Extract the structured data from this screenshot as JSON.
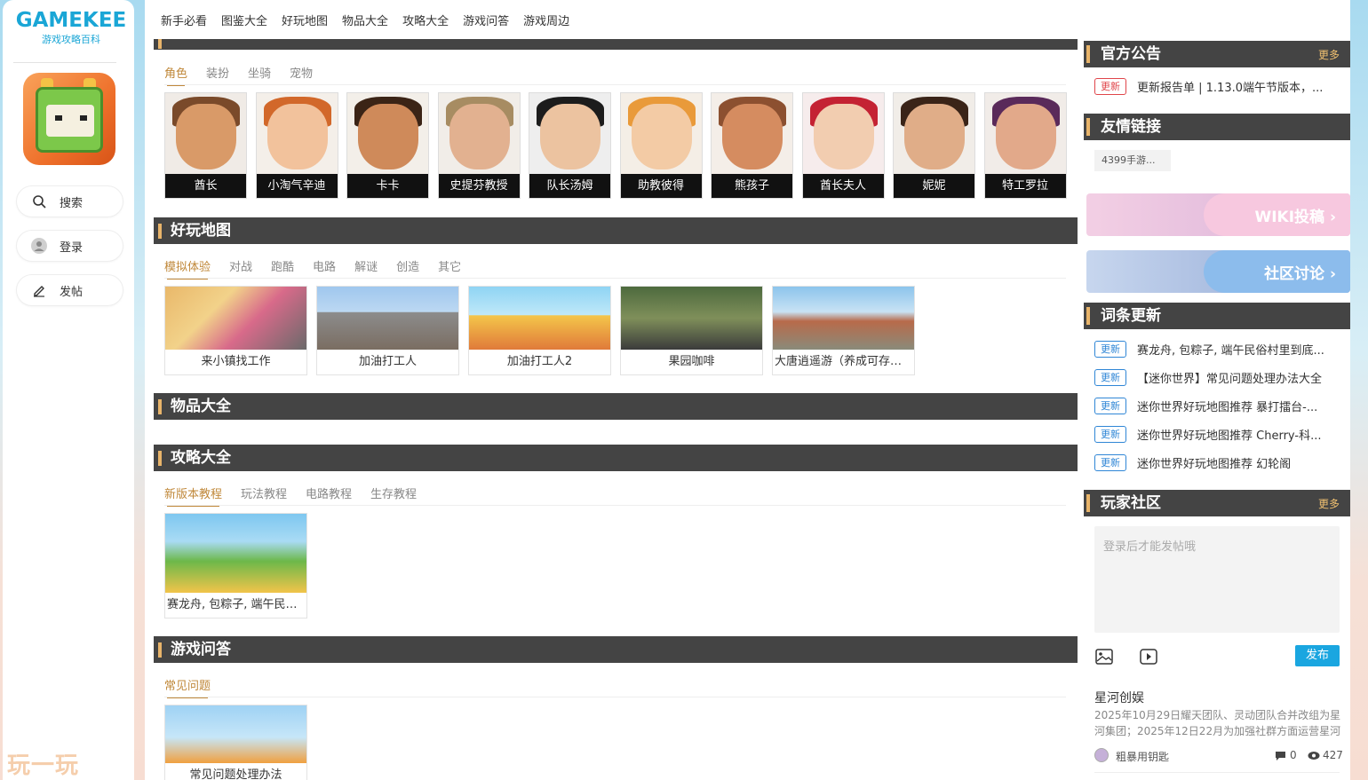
{
  "logo": {
    "text": "GAMEKEE",
    "subtitle": "游戏攻略百科"
  },
  "sidebar": {
    "search": "搜索",
    "login": "登录",
    "post": "发帖"
  },
  "watermark": "玩一玩",
  "nav": [
    "新手必看",
    "图鉴大全",
    "好玩地图",
    "物品大全",
    "攻略大全",
    "游戏问答",
    "游戏周边"
  ],
  "tujian": {
    "tabs": [
      "角色",
      "装扮",
      "坐骑",
      "宠物"
    ],
    "characters": [
      "酋长",
      "小淘气辛迪",
      "卡卡",
      "史提芬教授",
      "队长汤姆",
      "助教彼得",
      "熊孩子",
      "酋长夫人",
      "妮妮",
      "特工罗拉"
    ]
  },
  "maps": {
    "title": "好玩地图",
    "tabs": [
      "模拟体验",
      "对战",
      "跑酷",
      "电路",
      "解谜",
      "创造",
      "其它"
    ],
    "cards": [
      "来小镇找工作",
      "加油打工人",
      "加油打工人2",
      "果园咖啡",
      "大唐逍遥游（养成可存档）"
    ]
  },
  "items": {
    "title": "物品大全"
  },
  "guides": {
    "title": "攻略大全",
    "tabs": [
      "新版本教程",
      "玩法教程",
      "电路教程",
      "生存教程"
    ],
    "cards": [
      "赛龙舟, 包粽子, 端午民俗..."
    ]
  },
  "qa": {
    "title": "游戏问答",
    "tabs": [
      "常见问题"
    ],
    "cards": [
      "常见问题处理办法"
    ]
  },
  "right": {
    "announce": {
      "title": "官方公告",
      "more": "更多",
      "badge": "更新",
      "text": "更新报告单 | 1.13.0端午节版本，..."
    },
    "links": {
      "title": "友情链接",
      "chip": "4399手游..."
    },
    "wiki_banner": "WIKI投稿",
    "community_banner": "社区讨论",
    "updates": {
      "title": "词条更新",
      "items": [
        {
          "badge": "更新",
          "text": "赛龙舟, 包粽子, 端午民俗村里到底..."
        },
        {
          "badge": "更新",
          "text": "【迷你世界】常见问题处理办法大全"
        },
        {
          "badge": "更新",
          "text": "迷你世界好玩地图推荐 暴打擂台-..."
        },
        {
          "badge": "更新",
          "text": "迷你世界好玩地图推荐 Cherry-科..."
        },
        {
          "badge": "更新",
          "text": "迷你世界好玩地图推荐 幻轮阁"
        }
      ]
    },
    "community": {
      "title": "玩家社区",
      "more": "更多",
      "placeholder": "登录后才能发帖哦",
      "publish": "发布",
      "post_title": "星河创娱",
      "post_body": "2025年10月29日耀天团队、灵动团队合并改组为星河集团；2025年12日22月为加强社群方面运营星河",
      "author": "粗暴用钥匙",
      "comments": "0",
      "views": "427"
    }
  },
  "colors": {
    "accent": "#c0883a",
    "header_bg": "#444444",
    "brand_blue": "#1aa6d6"
  }
}
